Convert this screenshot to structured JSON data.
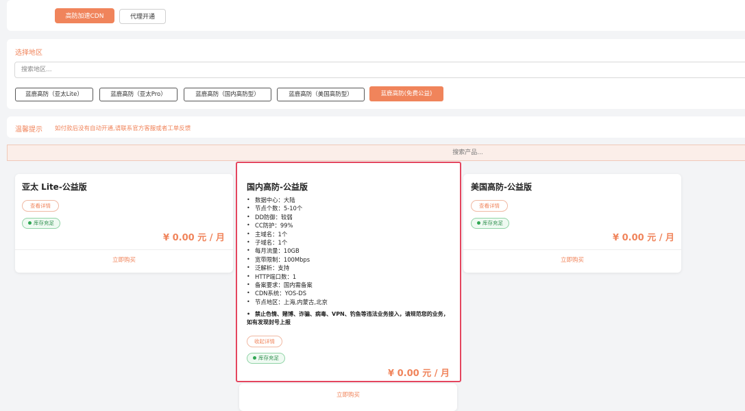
{
  "top_tabs": [
    {
      "label": "高防加速CDN",
      "active": true
    },
    {
      "label": "代理开通",
      "active": false
    }
  ],
  "region": {
    "title": "选择地区",
    "search_placeholder": "搜索地区...",
    "options": [
      {
        "label": "蓝鹿高防（亚太Lite）",
        "active": false
      },
      {
        "label": "蓝鹿高防（亚太Pro）",
        "active": false
      },
      {
        "label": "蓝鹿高防（国内高防型）",
        "active": false
      },
      {
        "label": "蓝鹿高防（美国高防型）",
        "active": false
      },
      {
        "label": "蓝鹿高防(免费公益)",
        "active": true
      }
    ]
  },
  "tip": {
    "label": "温馨提示",
    "text": "如付款后没有自动开通,请联系官方客服或者工单反馈"
  },
  "product_search_placeholder": "搜索产品...",
  "products": [
    {
      "title": "亚太 Lite-公益版",
      "detail_label": "查看详情",
      "stock_label": "库存充足",
      "price": "¥ 0.00 元 / 月",
      "buy_label": "立即购买"
    },
    {
      "title": "国内高防-公益版",
      "features": [
        "数据中心：大陆",
        "节点个数：5-10个",
        "DD防御：较弱",
        "CC防护：99%",
        "主域名：1个",
        "子域名：1个",
        "每月流量：10GB",
        "宽带限制：100Mbps",
        "泛解析：支持",
        "HTTP端口数：1",
        "备案要求：国内需备案",
        "CDN系统：YOS-DS",
        "节点地区：上海,内蒙古,北京"
      ],
      "warning_line1": "禁止色情、赌博、诈骗、病毒、VPN、钓鱼等违法业务接入，请规范您的业务，",
      "warning_line2": "如有发现封号上报",
      "detail_label": "收起详情",
      "stock_label": "库存充足",
      "price": "¥ 0.00 元 / 月",
      "buy_label": "立即购买"
    },
    {
      "title": "美国高防-公益版",
      "detail_label": "查看详情",
      "stock_label": "库存充足",
      "price": "¥ 0.00 元 / 月",
      "buy_label": "立即购买"
    }
  ],
  "colors": {
    "accent": "#f0845b",
    "highlight_border": "#e4455e",
    "stock_green": "#2fa653"
  }
}
